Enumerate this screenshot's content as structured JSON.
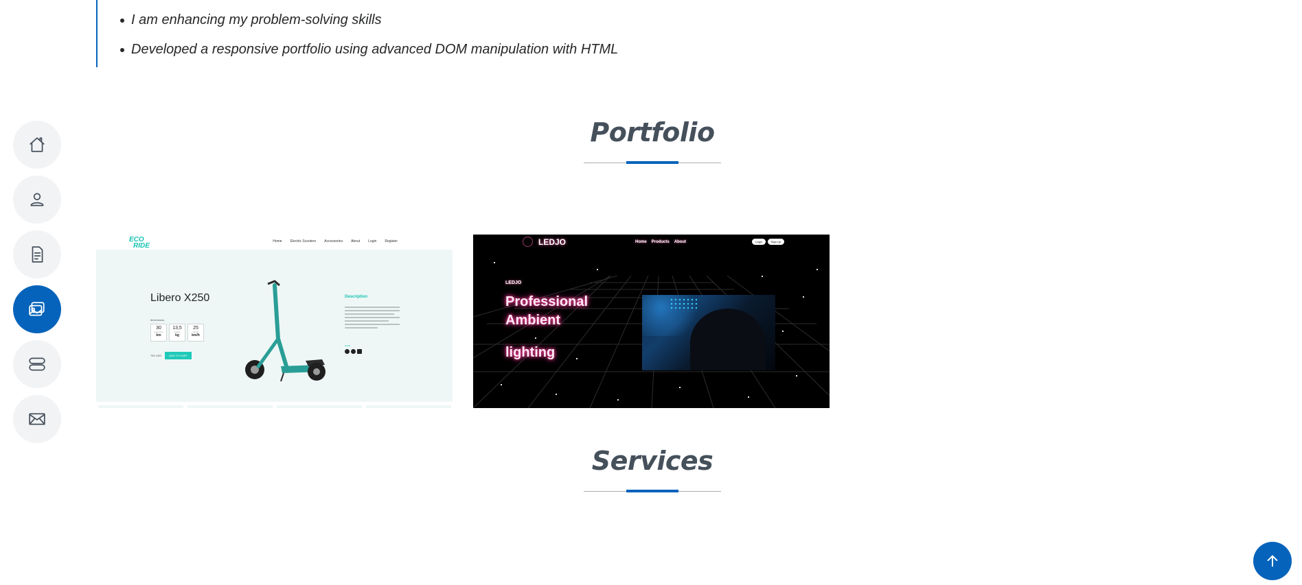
{
  "resume": {
    "items": [
      "I am enhancing my problem-solving skills",
      "Developed a responsive portfolio using advanced DOM manipulation with HTML"
    ]
  },
  "nav": {
    "items": [
      {
        "icon": "home-icon",
        "active": false
      },
      {
        "icon": "person-icon",
        "active": false
      },
      {
        "icon": "document-icon",
        "active": false
      },
      {
        "icon": "images-icon",
        "active": true
      },
      {
        "icon": "server-icon",
        "active": false
      },
      {
        "icon": "envelope-icon",
        "active": false
      }
    ],
    "accent_color": "#0563bb"
  },
  "portfolio": {
    "title": "Portfolio",
    "cards": {
      "eco": {
        "logo_line1": "ECO",
        "logo_line2": "RIDE",
        "menu": [
          "Home",
          "Electric Scooters",
          "Accessories",
          "About",
          "Login",
          "Register"
        ],
        "model": "Libero X250",
        "dimensions_label": "dimensions",
        "stats": [
          {
            "value": "30",
            "sub": "autonomy",
            "unit": "km"
          },
          {
            "value": "13,5",
            "sub": "weight",
            "unit": "kg"
          },
          {
            "value": "25",
            "sub": "speed",
            "unit": "km/h"
          }
        ],
        "price_label": "750 USD",
        "cart_label": "ADD TO CART",
        "description_heading": "Description",
        "social_heading": "Social"
      },
      "led": {
        "brand": "LEDJO",
        "menu": [
          "Home",
          "Products",
          "About"
        ],
        "buttons": [
          "Login",
          "Sign Up"
        ],
        "mini_brand": "LEDJO",
        "headline_line1": "Professional",
        "headline_line2": "Ambient",
        "headline_line3": "lighting"
      }
    }
  },
  "services": {
    "title": "Services"
  },
  "back_to_top": {
    "icon": "arrow-up-icon"
  }
}
